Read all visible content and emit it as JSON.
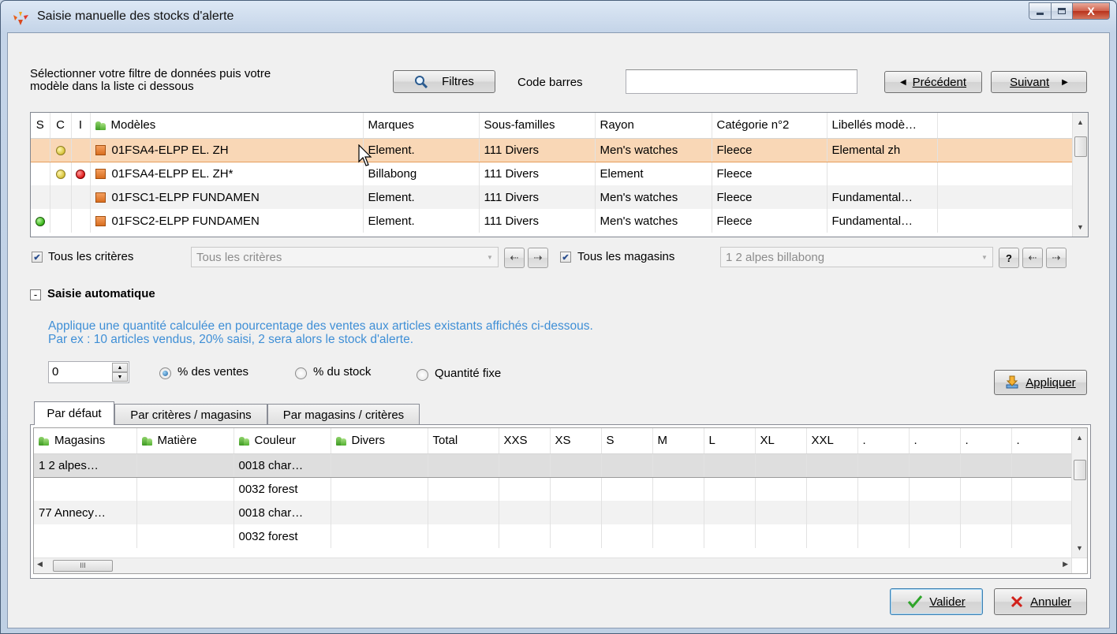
{
  "window": {
    "title": "Saisie manuelle des stocks d'alerte",
    "close_glyph": "X"
  },
  "toolbar": {
    "instruction_line1": "Sélectionner votre filtre de données puis votre",
    "instruction_line2": "modèle dans la liste ci dessous",
    "filtres_label": "Filtres",
    "code_barres_label": "Code barres",
    "code_barres_value": "",
    "precedent_label": "Précédent",
    "suivant_label": "Suivant"
  },
  "models_grid": {
    "headers": [
      "S",
      "C",
      "I",
      "Modèles",
      "Marques",
      "Sous-familles",
      "Rayon",
      "Catégorie n°2",
      "Libellés modè…"
    ],
    "rows": [
      {
        "s": "",
        "c": "yellow",
        "i": "",
        "model": "01FSA4-ELPP EL. ZH",
        "marque": "Element.",
        "sousfam": "111 Divers",
        "rayon": "Men's watches",
        "cat": "Fleece",
        "libelle": "Elemental  zh"
      },
      {
        "s": "",
        "c": "yellow",
        "i": "red",
        "model": "01FSA4-ELPP EL. ZH*",
        "marque": "Billabong",
        "sousfam": "111 Divers",
        "rayon": "Element",
        "cat": "Fleece",
        "libelle": ""
      },
      {
        "s": "",
        "c": "",
        "i": "",
        "model": "01FSC1-ELPP FUNDAMEN",
        "marque": "Element.",
        "sousfam": "111 Divers",
        "rayon": "Men's watches",
        "cat": "Fleece",
        "libelle": "Fundamental…"
      },
      {
        "s": "green",
        "c": "",
        "i": "",
        "model": "01FSC2-ELPP FUNDAMEN",
        "marque": "Element.",
        "sousfam": "111 Divers",
        "rayon": "Men's watches",
        "cat": "Fleece",
        "libelle": "Fundamental…"
      }
    ]
  },
  "filters": {
    "tous_criteres_label": "Tous les critères",
    "tous_criteres_checked": true,
    "criteres_combo_value": "Tous les critères",
    "tous_magasins_label": "Tous les magasins",
    "tous_magasins_checked": true,
    "magasins_combo_value": "1 2 alpes billabong",
    "help_label": "?"
  },
  "auto": {
    "section_label": "Saisie automatique",
    "collapse_glyph": "-",
    "info_line1": "Applique une quantité calculée en pourcentage des ventes aux articles existants affichés ci-dessous.",
    "info_line2": "Par ex : 10 articles vendus, 20% saisi, 2 sera alors le stock d'alerte.",
    "value": "0",
    "options": [
      "% des ventes",
      "% du stock",
      "Quantité fixe"
    ],
    "selected_option": "% des ventes",
    "appliquer_label": "Appliquer"
  },
  "tabs": [
    "Par défaut",
    "Par critères / magasins",
    "Par magasins / critères"
  ],
  "active_tab": "Par défaut",
  "stock_grid": {
    "headers": [
      "Magasins",
      "Matière",
      "Couleur",
      "Divers",
      "Total",
      "XXS",
      "XS",
      "S",
      "M",
      "L",
      "XL",
      "XXL",
      ".",
      ".",
      ".",
      "."
    ],
    "rows": [
      {
        "magasin": "1 2 alpes…",
        "matiere": "",
        "couleur": "0018  char…"
      },
      {
        "magasin": "",
        "matiere": "",
        "couleur": "0032  forest"
      },
      {
        "magasin": "77 Annecy…",
        "matiere": "",
        "couleur": "0018  char…"
      },
      {
        "magasin": "",
        "matiere": "",
        "couleur": "0032  forest"
      }
    ],
    "hscroll_grip": "III"
  },
  "footer": {
    "valider_label": "Valider",
    "annuler_label": "Annuler"
  },
  "colors": {
    "selection": "#f9d7b6",
    "info_text": "#3f8fd6",
    "tab_border": "#898c95"
  }
}
